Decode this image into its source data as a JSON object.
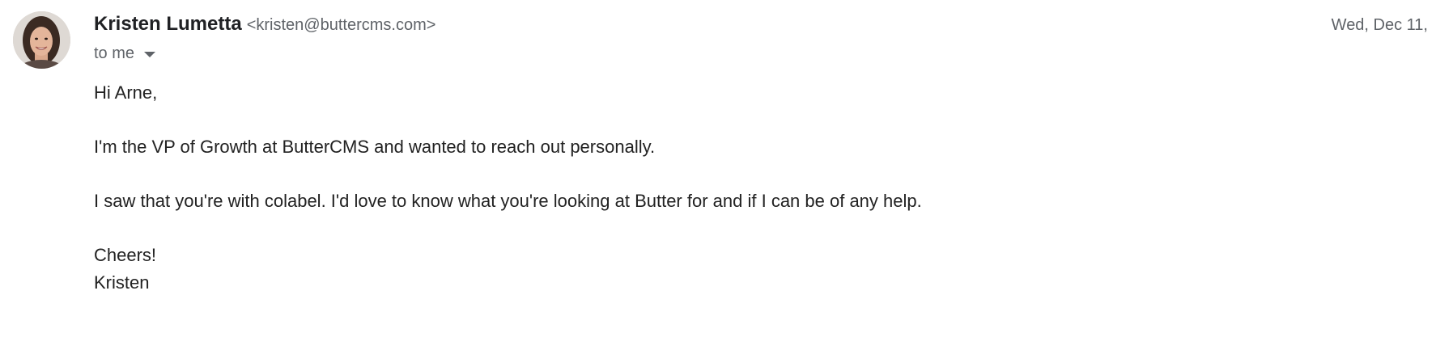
{
  "sender": {
    "name": "Kristen Lumetta",
    "email": "<kristen@buttercms.com>"
  },
  "date": "Wed, Dec 11,",
  "recipient": {
    "label": "to me",
    "dropdown_icon": "caret-down-icon"
  },
  "avatar": {
    "icon": "profile-photo"
  },
  "message": {
    "greeting": "Hi Arne,",
    "paragraph1": "I'm the VP of Growth at ButterCMS and wanted to reach out personally.",
    "paragraph2": "I saw that you're with colabel. I'd love to know what you're looking at Butter for and if I can be of any help.",
    "closing": "Cheers!",
    "signature": "Kristen"
  }
}
